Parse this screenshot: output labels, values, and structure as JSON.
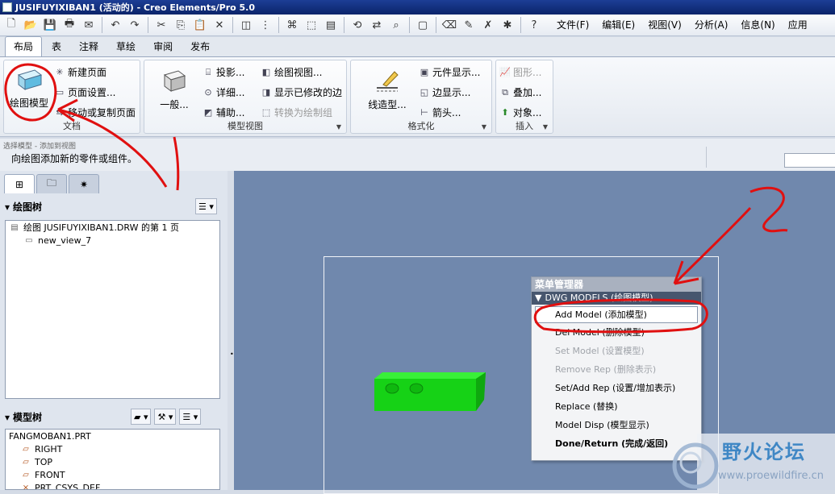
{
  "window": {
    "title": "JUSIFUYIXIBAN1 (活动的) - Creo Elements/Pro 5.0"
  },
  "toolbar": {
    "icons": [
      "new-file-icon",
      "open-folder-icon",
      "save-icon",
      "print-icon",
      "email-icon",
      "undo-icon",
      "redo-icon",
      "cut-icon",
      "copy-icon",
      "paste-icon",
      "delete-icon",
      "layers-icon",
      "tree-icon",
      "find-icon",
      "select-box-icon",
      "info-icon",
      "regenerate-icon",
      "refresh-icon",
      "zoom-icon",
      "view-icon",
      "eraser-icon",
      "edit-icon",
      "datum-icon",
      "datum-axis-icon",
      "help-icon"
    ],
    "menu": [
      "文件(F)",
      "编辑(E)",
      "视图(V)",
      "分析(A)",
      "信息(N)",
      "应用"
    ]
  },
  "ribbon": {
    "tabs": [
      "布局",
      "表",
      "注释",
      "草绘",
      "审阅",
      "发布"
    ],
    "active_tab": "布局",
    "groups": {
      "document": {
        "label": "文档",
        "big": "绘图模型",
        "items": [
          "新建页面",
          "页面设置...",
          "移动或复制页面"
        ]
      },
      "model_views": {
        "label": "模型视图",
        "big": "一般...",
        "col1": [
          "投影...",
          "详细...",
          "辅助..."
        ],
        "col2": [
          "绘图视图...",
          "显示已修改的边",
          "转换为绘制组"
        ]
      },
      "format": {
        "label": "格式化",
        "big": "线造型...",
        "items": [
          "元件显示...",
          "边显示...",
          "箭头..."
        ]
      },
      "insert": {
        "label": "插入",
        "items": [
          "图形...",
          "叠加...",
          "对象..."
        ]
      }
    }
  },
  "hintbar": {
    "prev": "选择模型 - 添加到视图",
    "message": "向绘图添加新的零件或组件。"
  },
  "left_panel": {
    "drawing_tree": {
      "title": "绘图树",
      "items": [
        "绘图 JUSIFUYIXIBAN1.DRW 的第 1 页",
        "new_view_7"
      ]
    },
    "model_tree": {
      "title": "模型树",
      "items": [
        "FANGMOBAN1.PRT",
        "RIGHT",
        "TOP",
        "FRONT",
        "PRT_CSYS_DEF"
      ]
    }
  },
  "menu_manager": {
    "title": "菜单管理器",
    "header": "DWG MODELS (绘图模型)",
    "items": [
      {
        "label": "Add Model (添加模型)",
        "state": "selected"
      },
      {
        "label": "Del Model (删除模型)",
        "state": "normal"
      },
      {
        "label": "Set Model (设置模型)",
        "state": "disabled"
      },
      {
        "label": "Remove Rep (删除表示)",
        "state": "disabled"
      },
      {
        "label": "Set/Add Rep (设置/增加表示)",
        "state": "normal"
      },
      {
        "label": "Replace (替换)",
        "state": "normal"
      },
      {
        "label": "Model Disp (模型显示)",
        "state": "normal"
      },
      {
        "label": "Done/Return (完成/返回)",
        "state": "bold"
      }
    ]
  },
  "annotations": {
    "step1": "1",
    "step2": "2"
  },
  "watermark": {
    "text": "野火论坛",
    "url": "www.proewildfire.cn"
  },
  "colors": {
    "canvas": "#7088ad",
    "part": "#1ee01e",
    "annotation": "#e01010",
    "ribbon_active": "#ffffff"
  }
}
